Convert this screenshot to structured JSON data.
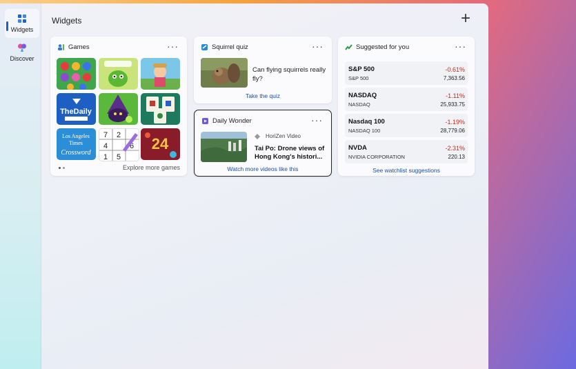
{
  "nav": {
    "widgets_label": "Widgets",
    "discover_label": "Discover"
  },
  "header": {
    "title": "Widgets",
    "add_symbol": "+"
  },
  "games": {
    "title": "Games",
    "more": "···",
    "explore": "Explore more games",
    "tiles": [
      "Candy",
      "Cut the Rope",
      "Farm",
      "TheDaily Crossword",
      "Wizard",
      "Mahjong",
      "Los Angeles Times Crossword",
      "Sudoku",
      "2048"
    ]
  },
  "quiz": {
    "title": "Squirrel quiz",
    "more": "···",
    "question": "Can flying squirrels really fly?",
    "cta": "Take the quiz"
  },
  "wonder": {
    "title": "Daily Wonder",
    "more": "···",
    "source": "HoriZen Video",
    "video_title": "Tai Po: Drone views of Hong Kong's histori...",
    "cta": "Watch more videos like this"
  },
  "stocks": {
    "title": "Suggested for you",
    "more": "···",
    "items": [
      {
        "name": "S&P 500",
        "sub": "S&P 500",
        "change": "-0.61%",
        "value": "7,363.56"
      },
      {
        "name": "NASDAQ",
        "sub": "NASDAQ",
        "change": "-1.11%",
        "value": "25,933.75"
      },
      {
        "name": "Nasdaq 100",
        "sub": "NASDAQ 100",
        "change": "-1.19%",
        "value": "28,779.06"
      },
      {
        "name": "NVDA",
        "sub": "NVIDIA CORPORATION",
        "change": "-2.31%",
        "value": "220.13"
      }
    ],
    "cta": "See watchlist suggestions"
  },
  "colors": {
    "accent": "#1565c0",
    "negative": "#c42b1c",
    "link": "#1a4fa0"
  }
}
